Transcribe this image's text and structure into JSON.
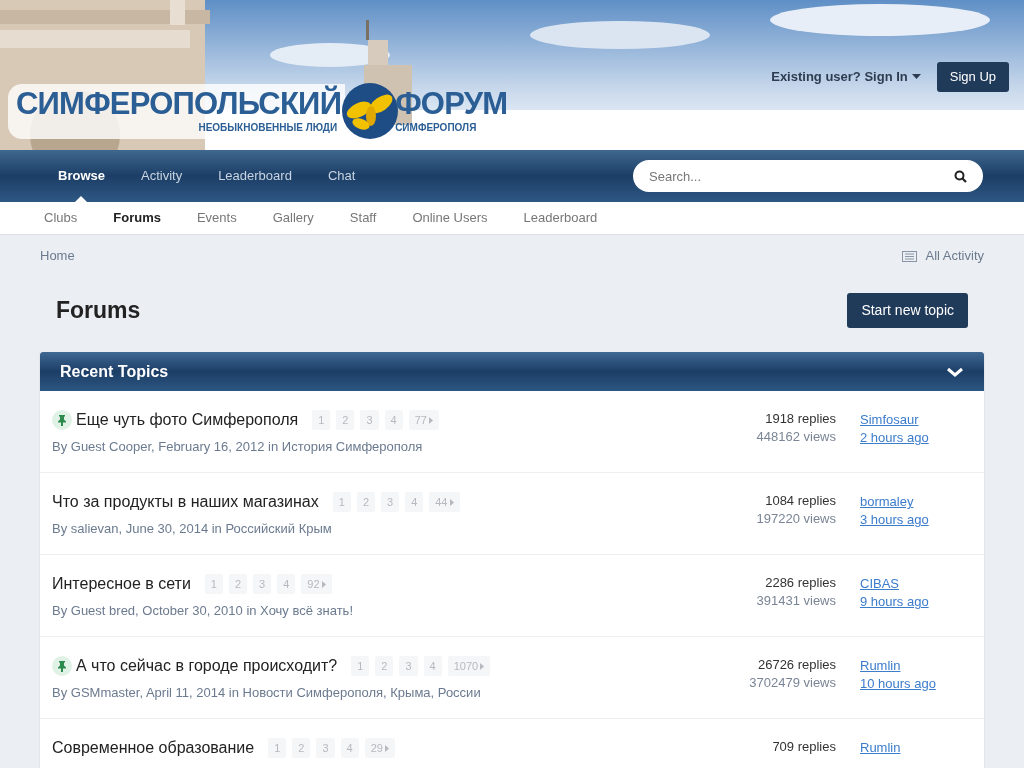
{
  "logo": {
    "title_left": "СИМФЕРОПОЛЬСКИЙ",
    "title_right": "ФОРУМ",
    "tagline_left": "НЕОБЫКНОВЕННЫЕ ЛЮДИ",
    "tagline_right": "СИМФЕРОПОЛЯ"
  },
  "user_bar": {
    "sign_in": "Existing user? Sign In",
    "sign_up": "Sign Up"
  },
  "nav": [
    {
      "label": "Browse",
      "selected": true
    },
    {
      "label": "Activity",
      "selected": false
    },
    {
      "label": "Leaderboard",
      "selected": false
    },
    {
      "label": "Chat",
      "selected": false
    }
  ],
  "search": {
    "placeholder": "Search..."
  },
  "subnav": [
    {
      "label": "Clubs",
      "selected": false
    },
    {
      "label": "Forums",
      "selected": true
    },
    {
      "label": "Events",
      "selected": false
    },
    {
      "label": "Gallery",
      "selected": false
    },
    {
      "label": "Staff",
      "selected": false
    },
    {
      "label": "Online Users",
      "selected": false
    },
    {
      "label": "Leaderboard",
      "selected": false
    }
  ],
  "breadcrumb": "Home",
  "all_activity": "All Activity",
  "page_title": "Forums",
  "new_topic": "Start new topic",
  "panel": {
    "title": "Recent Topics",
    "expanded": true
  },
  "topics": [
    {
      "title": "Еще чуть фото Симферополя",
      "pinned": true,
      "pages": [
        "1",
        "2",
        "3",
        "4",
        "77"
      ],
      "meta": "By Guest Cooper, February 16, 2012 in История Симферополя",
      "replies": "1918 replies",
      "views": "448162 views",
      "last_user": "Simfosaur",
      "last_time": "2 hours ago"
    },
    {
      "title": "Что за продукты в наших магазинах",
      "pinned": false,
      "pages": [
        "1",
        "2",
        "3",
        "4",
        "44"
      ],
      "meta": "By salievan, June 30, 2014 in Российский Крым",
      "replies": "1084 replies",
      "views": "197220 views",
      "last_user": "bormaley",
      "last_time": "3 hours ago"
    },
    {
      "title": "Интересное в сети",
      "pinned": false,
      "pages": [
        "1",
        "2",
        "3",
        "4",
        "92"
      ],
      "meta": "By Guest bred, October 30, 2010 in Хочу всё знать!",
      "replies": "2286 replies",
      "views": "391431 views",
      "last_user": "CIBAS",
      "last_time": "9 hours ago"
    },
    {
      "title": "А что сейчас в городе происходит?",
      "pinned": true,
      "pages": [
        "1",
        "2",
        "3",
        "4",
        "1070"
      ],
      "meta": "By GSMmaster, April 11, 2014 in Новости Симферополя, Крыма, России",
      "replies": "26726 replies",
      "views": "3702479 views",
      "last_user": "Rumlin",
      "last_time": "10 hours ago"
    },
    {
      "title": "Современное образование",
      "pinned": false,
      "pages": [
        "1",
        "2",
        "3",
        "4",
        "29"
      ],
      "replies": "709 replies",
      "last_user": "Rumlin"
    }
  ]
}
